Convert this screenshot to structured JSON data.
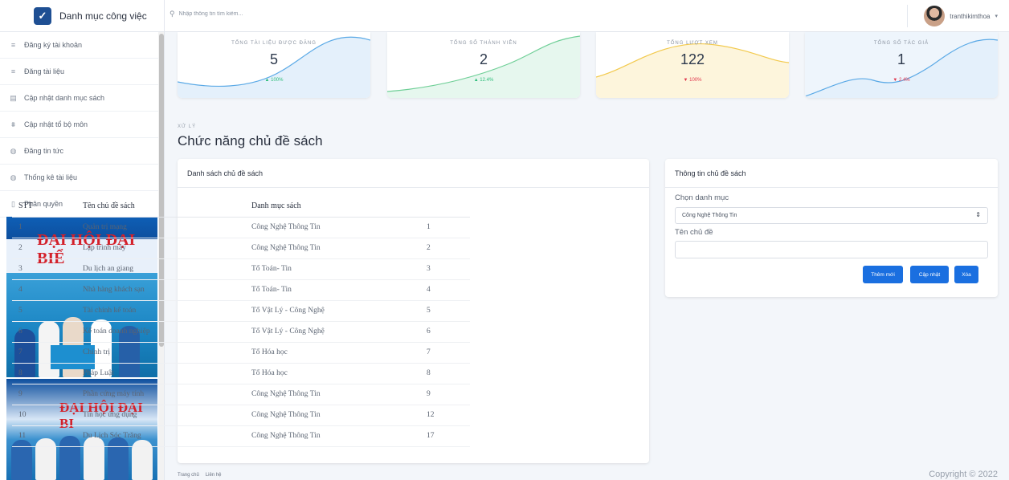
{
  "brand": {
    "name": "Danh mục công việc"
  },
  "sidebar": {
    "items": [
      {
        "label": "Đăng ký tài khoản",
        "icon": "list-icon"
      },
      {
        "label": "Đăng tài liệu",
        "icon": "list-icon"
      },
      {
        "label": "Cập nhật danh mục sách",
        "icon": "table-icon"
      },
      {
        "label": "Cập nhật tổ bộ môn",
        "icon": "align-icon"
      },
      {
        "label": "Đăng tin tức",
        "icon": "circle-icon"
      },
      {
        "label": "Thống kê tài liệu",
        "icon": "circle-icon"
      },
      {
        "label": "Phân quyền",
        "icon": "file-icon"
      }
    ],
    "banner1": "ĐẠI HỘI ĐẠI BIỂ",
    "banner2": "ĐẠI HỘI ĐẠI BI"
  },
  "search": {
    "placeholder": "Nhập thông tin tìm kiếm..."
  },
  "user": {
    "name": "tranthikimthoa"
  },
  "stats": [
    {
      "title": "TỔNG TÀI LIỆU ĐƯỢC ĐĂNG",
      "value": "5",
      "change": "▲ 100%",
      "trend": "up",
      "color": "#5aa9e6",
      "fill": "#e4f0fb"
    },
    {
      "title": "TỔNG SỐ THÀNH VIÊN",
      "value": "2",
      "change": "▲ 12.4%",
      "trend": "up",
      "color": "#6fcf97",
      "fill": "#e6f7ee"
    },
    {
      "title": "TỔNG LƯỢT XEM",
      "value": "122",
      "change": "▼ 100%",
      "trend": "down",
      "color": "#f2c94c",
      "fill": "#fdf5dc"
    },
    {
      "title": "TỔNG SỐ TÁC GIẢ",
      "value": "1",
      "change": "▼ 2.4%",
      "trend": "down",
      "color": "#5aa9e6",
      "fill": "#e4f0fb"
    }
  ],
  "section": {
    "pretitle": "XỬ LÝ",
    "title": "Chức năng chủ đề sách"
  },
  "list_card": {
    "title": "Danh sách chủ đề sách",
    "columns": [
      "STT",
      "Tên chủ đề sách",
      "Danh mục sách",
      ""
    ],
    "rows": [
      [
        "1",
        "Quản trị mạng",
        "Công Nghệ Thông Tin",
        "1"
      ],
      [
        "2",
        "Lập trình máy",
        "Công Nghệ Thông Tin",
        "2"
      ],
      [
        "3",
        "Du lịch an giang",
        "Tổ Toán- Tin",
        "3"
      ],
      [
        "4",
        "Nhà hàng khách sạn",
        "Tổ Toán- Tin",
        "4"
      ],
      [
        "5",
        "Tài chính kế toán",
        "Tổ Vật Lý - Công Nghệ",
        "5"
      ],
      [
        "6",
        "Kế toán doanh nghiệp",
        "Tổ Vật Lý - Công Nghệ",
        "6"
      ],
      [
        "7",
        "Chính trị",
        "Tổ Hóa học",
        "7"
      ],
      [
        "8",
        "Pháp Luật",
        "Tổ Hóa học",
        "8"
      ],
      [
        "9",
        "Phần cứng máy tính",
        "Công Nghệ Thông Tin",
        "9"
      ],
      [
        "10",
        "Tin học ứng dụng",
        "Công Nghệ Thông Tin",
        "12"
      ],
      [
        "11",
        "Du Lịch Sóc Trăng",
        "Công Nghệ Thông Tin",
        "17"
      ]
    ]
  },
  "info_card": {
    "title": "Thông tin chủ đề sách",
    "category_label": "Chọn danh mục",
    "category_value": "Công Nghệ Thông Tin",
    "topic_label": "Tên chủ đề",
    "topic_value": "",
    "add_label": "Thêm mới",
    "update_label": "Cập nhật",
    "delete_label": "Xóa"
  },
  "footer": {
    "home": "Trang chủ",
    "contact": "Liên hệ",
    "copyright": "Copyright © 2022"
  }
}
